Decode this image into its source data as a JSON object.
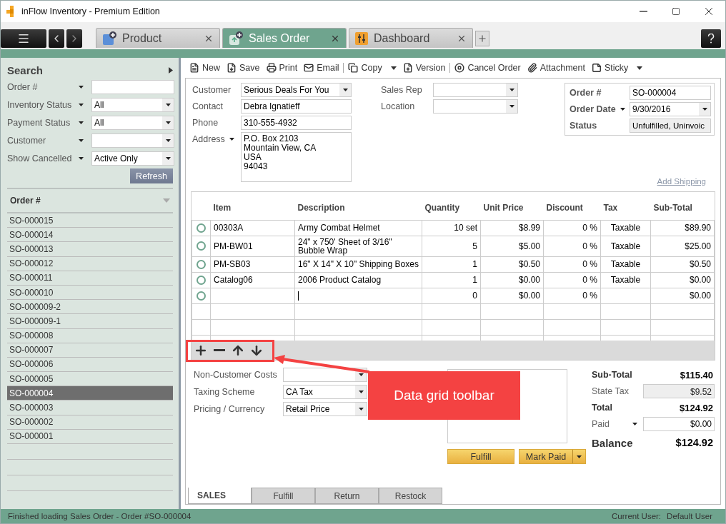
{
  "window": {
    "title": "inFlow Inventory - Premium Edition"
  },
  "tabs": [
    {
      "label": "Product",
      "kind": "product",
      "selected": false
    },
    {
      "label": "Sales Order",
      "kind": "order",
      "selected": true
    },
    {
      "label": "Dashboard",
      "kind": "dashboard",
      "selected": false
    }
  ],
  "search": {
    "title": "Search",
    "fields": [
      {
        "label": "Order #",
        "kind": "text"
      },
      {
        "label": "Inventory Status",
        "kind": "dropdown",
        "value": "All"
      },
      {
        "label": "Payment Status",
        "kind": "dropdown",
        "value": "All"
      },
      {
        "label": "Customer",
        "kind": "dropdown"
      },
      {
        "label": "Show Cancelled",
        "kind": "dropdown",
        "value": "Active Only"
      }
    ],
    "button": "Refresh"
  },
  "orders": {
    "column": "Order #",
    "items": [
      {
        "label": "SO-000015",
        "selected": false
      },
      {
        "label": "SO-000014",
        "selected": false
      },
      {
        "label": "SO-000013",
        "selected": false
      },
      {
        "label": "SO-000012",
        "selected": false
      },
      {
        "label": "SO-000011",
        "selected": false
      },
      {
        "label": "SO-000010",
        "selected": false
      },
      {
        "label": "SO-000009-2",
        "selected": false
      },
      {
        "label": "SO-000009-1",
        "selected": false
      },
      {
        "label": "SO-000008",
        "selected": false
      },
      {
        "label": "SO-000007",
        "selected": false
      },
      {
        "label": "SO-000006",
        "selected": false
      },
      {
        "label": "SO-000005",
        "selected": false
      },
      {
        "label": "SO-000004",
        "selected": true
      },
      {
        "label": "SO-000003",
        "selected": false
      },
      {
        "label": "SO-000002",
        "selected": false
      },
      {
        "label": "SO-000001",
        "selected": false
      }
    ]
  },
  "toolbar": [
    {
      "items": [
        {
          "label": "New",
          "kind": "new",
          "dropdown": false
        },
        {
          "label": "Save",
          "kind": "save",
          "dropdown": false
        },
        {
          "label": "Print",
          "kind": "print",
          "dropdown": false
        },
        {
          "label": "Email",
          "kind": "email",
          "dropdown": false
        }
      ]
    },
    {
      "items": [
        {
          "label": "Copy",
          "kind": "copy",
          "dropdown": true
        },
        {
          "label": "Version",
          "kind": "version",
          "dropdown": false
        }
      ]
    },
    {
      "items": [
        {
          "label": "Cancel Order",
          "kind": "cancel",
          "dropdown": false
        },
        {
          "label": "Attachment",
          "kind": "attachment",
          "dropdown": false
        },
        {
          "label": "Sticky",
          "kind": "sticky",
          "dropdown": true
        }
      ]
    }
  ],
  "header": {
    "customer": [
      {
        "label": "Customer",
        "kind": "dropdown",
        "value": "Serious Deals For You"
      },
      {
        "label": "Contact",
        "kind": "text",
        "value": "Debra Ignatieff"
      },
      {
        "label": "Phone",
        "kind": "text",
        "value": "310-555-4932"
      },
      {
        "label": "Address",
        "kind": "multiline",
        "lines": [
          "P.O. Box 2103",
          "Mountain View, CA",
          "USA",
          "94043"
        ]
      }
    ],
    "assignment": [
      {
        "label": "Sales Rep",
        "kind": "dropdown"
      },
      {
        "label": "Location",
        "kind": "dropdown"
      }
    ],
    "order": [
      {
        "label": "Order #",
        "kind": "text",
        "value": "SO-000004"
      },
      {
        "label": "Order Date",
        "kind": "date",
        "value": "9/30/2016"
      },
      {
        "label": "Status",
        "kind": "readonly",
        "value": "Unfulfilled, Uninvoic"
      }
    ],
    "link": "Add Shipping"
  },
  "grid": {
    "columns": [
      "Item",
      "Description",
      "Quantity",
      "Unit Price",
      "Discount",
      "Tax",
      "Sub-Total"
    ],
    "rows": [
      {
        "item": "00303A",
        "description": "Army Combat Helmet",
        "quantity": "10 set",
        "unit_price": "$8.99",
        "discount": "0 %",
        "tax": "Taxable",
        "subtotal": "$89.90",
        "editing": false
      },
      {
        "item": "PM-BW01",
        "description": "24\" x 750' Sheet of 3/16\" Bubble Wrap",
        "quantity": "5",
        "unit_price": "$5.00",
        "discount": "0 %",
        "tax": "Taxable",
        "subtotal": "$25.00",
        "editing": false
      },
      {
        "item": "PM-SB03",
        "description": "16\" X 14\" X 10\" Shipping Boxes",
        "quantity": "1",
        "unit_price": "$0.50",
        "discount": "0 %",
        "tax": "Taxable",
        "subtotal": "$0.50",
        "editing": false
      },
      {
        "item": "Catalog06",
        "description": "2006 Product Catalog",
        "quantity": "1",
        "unit_price": "$0.00",
        "discount": "0 %",
        "tax": "Taxable",
        "subtotal": "$0.00",
        "editing": false
      },
      {
        "quantity": "0",
        "unit_price": "$0.00",
        "discount": "0 %",
        "subtotal": "$0.00",
        "editing": true
      }
    ]
  },
  "costs": [
    {
      "label": "Non-Customer Costs"
    },
    {
      "label": "Taxing Scheme",
      "value": "CA Tax"
    },
    {
      "label": "Pricing / Currency",
      "value": "Retail Price"
    }
  ],
  "actions": [
    {
      "label": "Fulfill",
      "kind": "plain"
    },
    {
      "label": "Mark Paid",
      "kind": "split"
    }
  ],
  "totals": [
    {
      "label": "Sub-Total",
      "value": "$115.40",
      "kind": "bold"
    },
    {
      "label": "State Tax",
      "value": "$9.52",
      "kind": "readonly"
    },
    {
      "label": "Total",
      "value": "$124.92",
      "kind": "bold"
    },
    {
      "label": "Paid",
      "value": "$0.00",
      "kind": "input"
    },
    {
      "label": "Balance",
      "value": "$124.92",
      "kind": "large"
    }
  ],
  "bottom_tabs": [
    {
      "label": "SALES",
      "selected": true
    },
    {
      "label": "Fulfill",
      "selected": false
    },
    {
      "label": "Return",
      "selected": false
    },
    {
      "label": "Restock",
      "selected": false
    }
  ],
  "status_bar": {
    "message": "Finished loading Sales Order - Order #SO-000004",
    "user_label": "Current User:",
    "user": "Default User"
  },
  "annotation": {
    "text": "Data grid toolbar"
  }
}
